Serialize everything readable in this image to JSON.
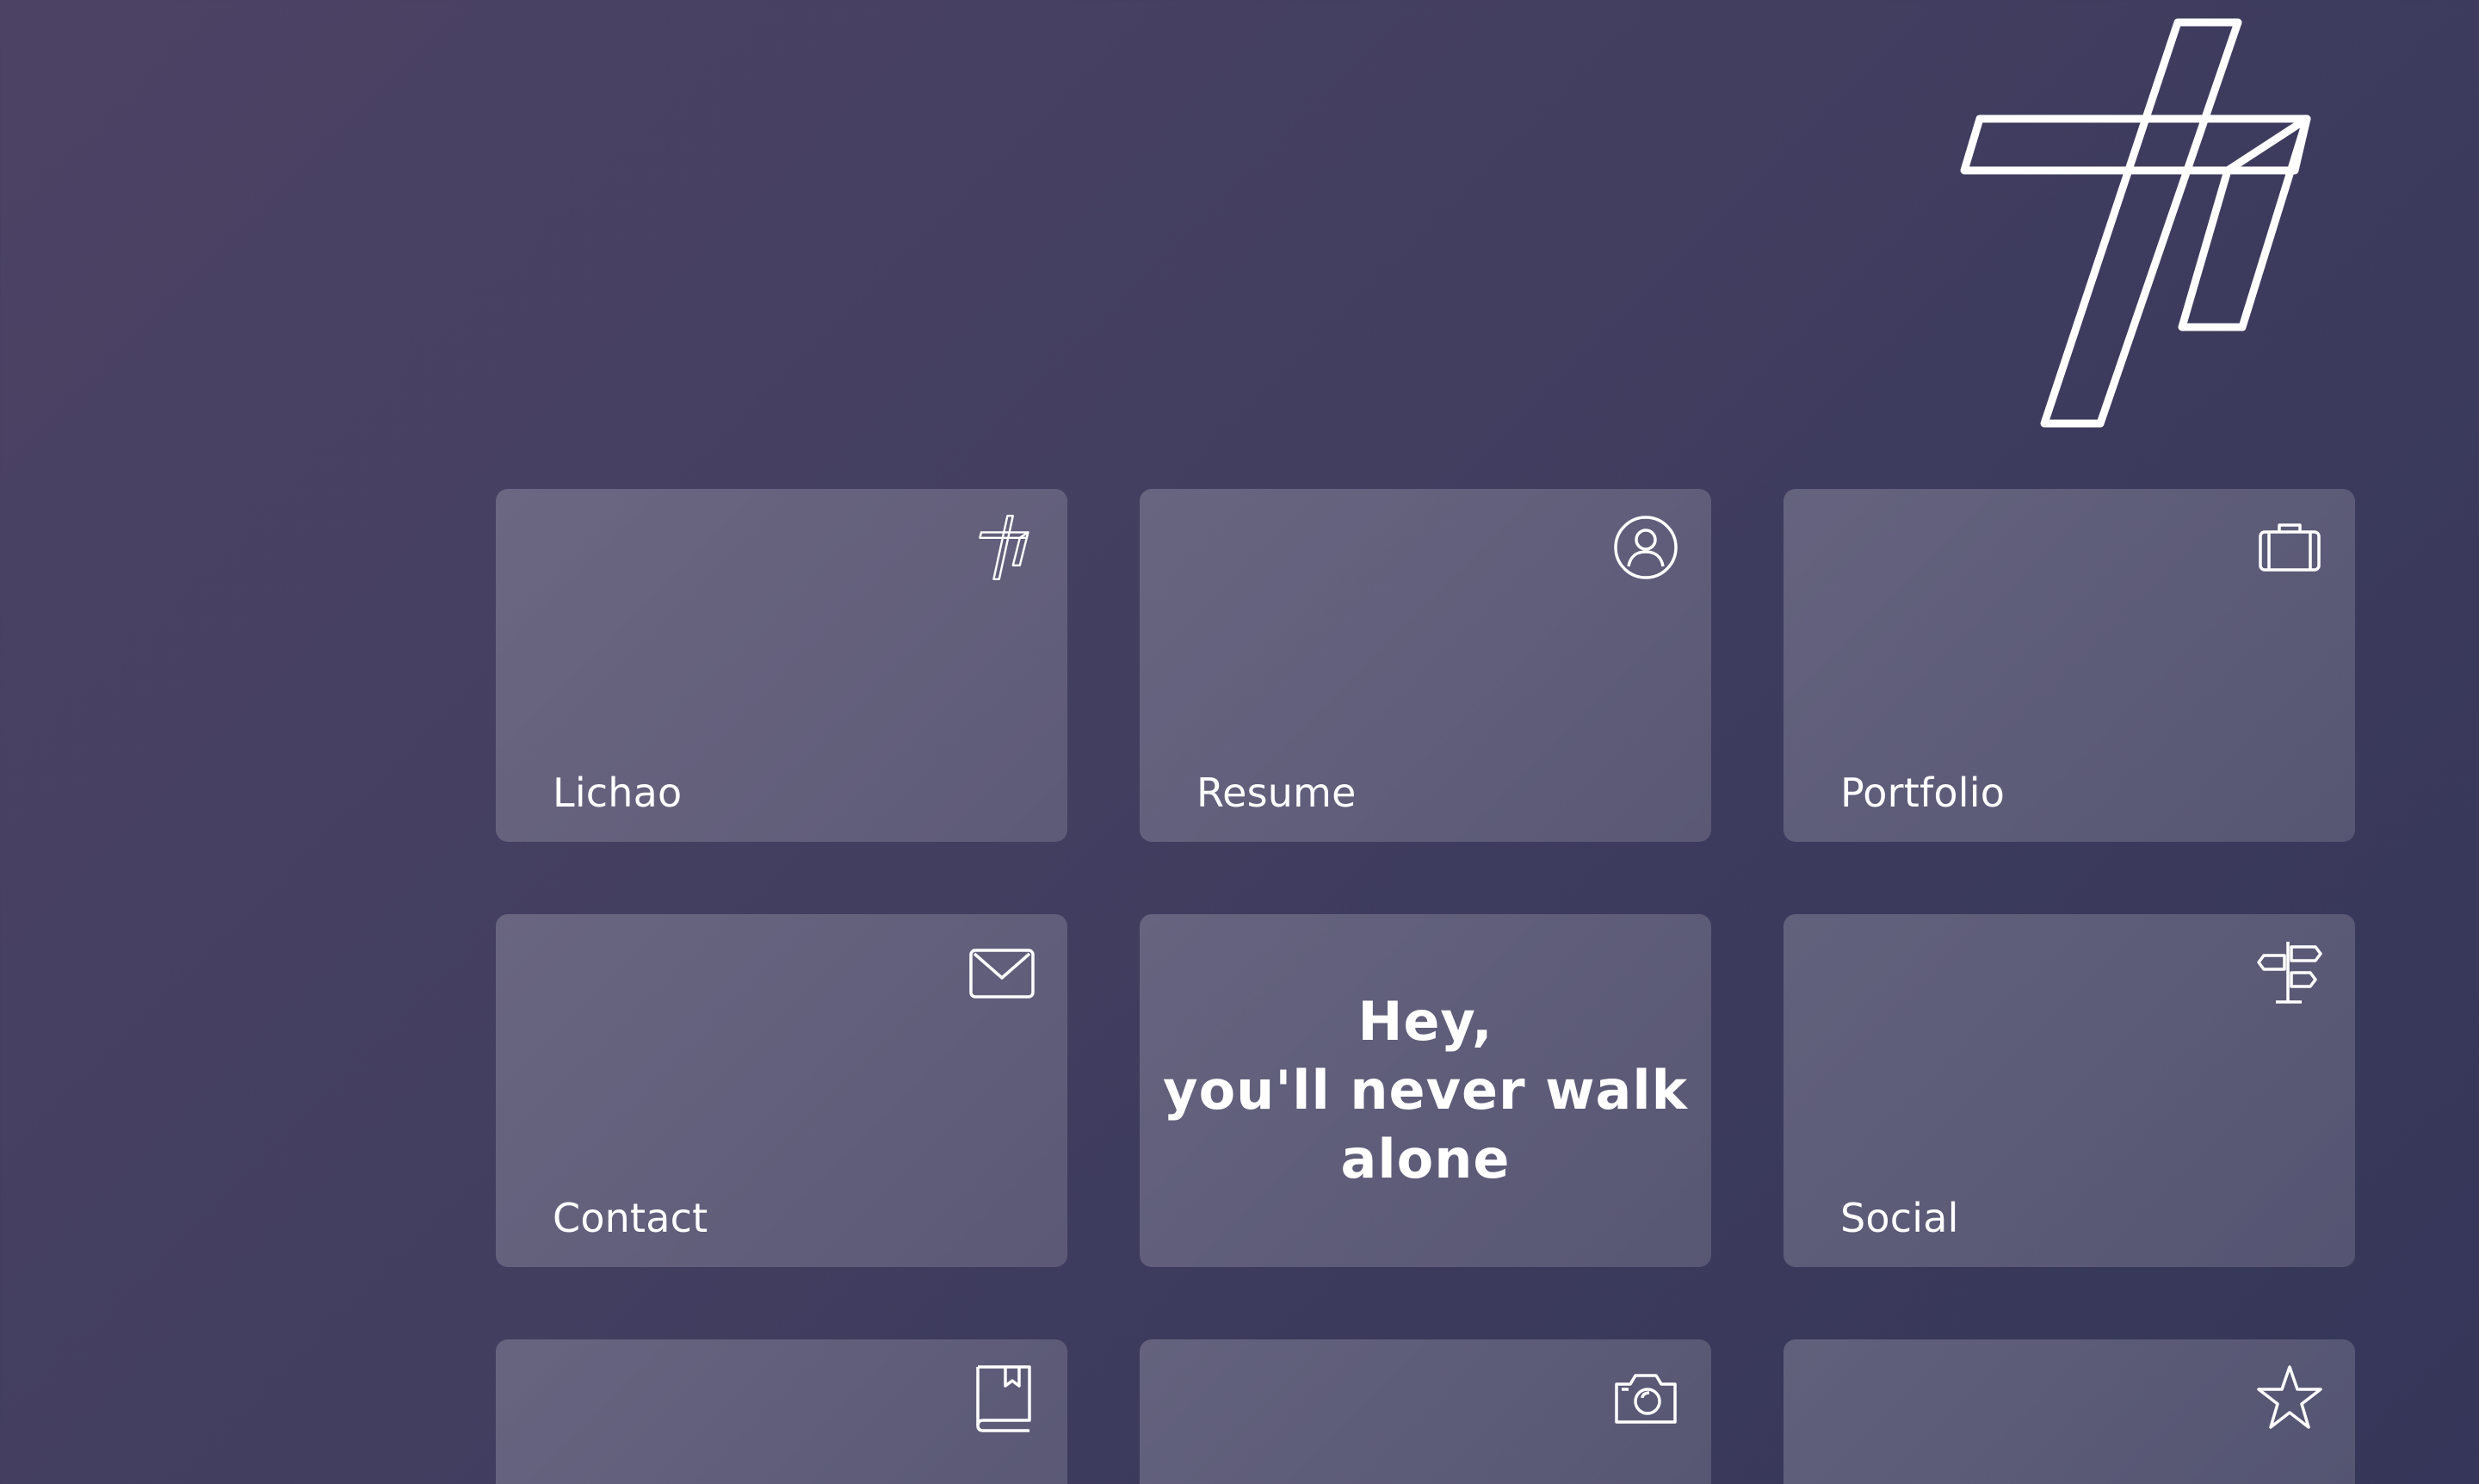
{
  "brand": {
    "logo_icon": "lichao-monogram-logo"
  },
  "tiles": [
    {
      "label": "Lichao",
      "icon": "lichao-logo-icon"
    },
    {
      "label": "Resume",
      "icon": "user-circle-icon"
    },
    {
      "label": "Portfolio",
      "icon": "briefcase-icon"
    },
    {
      "label": "Contact",
      "icon": "envelope-icon"
    },
    {
      "label": "Social",
      "icon": "signpost-icon"
    },
    {
      "label": "",
      "icon": "book-icon"
    },
    {
      "label": "",
      "icon": "camera-icon"
    },
    {
      "label": "",
      "icon": "star-icon"
    }
  ],
  "motto": {
    "line1": "Hey,",
    "line2": "you'll never walk",
    "line3": "alone"
  },
  "colors": {
    "background_start": "#4c4264",
    "background_end": "#353659",
    "tile_overlay": "rgba(255,255,255,0.18)",
    "text": "#ffffff"
  }
}
